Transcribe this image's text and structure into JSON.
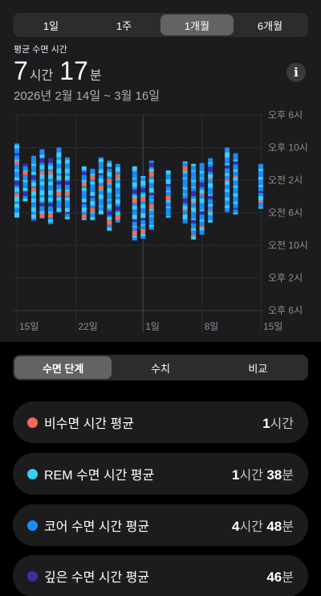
{
  "period_tabs": [
    {
      "label": "1일",
      "active": false
    },
    {
      "label": "1주",
      "active": false
    },
    {
      "label": "1개월",
      "active": true
    },
    {
      "label": "6개월",
      "active": false
    }
  ],
  "summary": {
    "label": "평균 수면 시간",
    "hours": "7",
    "hours_unit": "시간",
    "minutes": "17",
    "minutes_unit": "분",
    "info_icon": "i",
    "date_range": "2026년 2월 14일 ~ 3월 16일"
  },
  "chart_data": {
    "type": "bar",
    "y_ticks": [
      "오후 6시",
      "오후 10시",
      "오전 2시",
      "오전 6시",
      "오전 10시",
      "오후 2시",
      "오후 6시"
    ],
    "x_ticks": [
      "15일",
      "22일",
      "1일",
      "8일",
      "15일"
    ],
    "colors": {
      "awake": "#f46a52",
      "rem": "#3ad0f5",
      "core": "#1a8cff",
      "deep": "#3a2ea8"
    },
    "series": [
      {
        "day": "2월 14일",
        "bed": 21.5,
        "wake": 30.6
      },
      {
        "day": "2월 15일",
        "bed": 24.0,
        "wake": 28.6
      },
      {
        "day": "2월 16일",
        "bed": 23.0,
        "wake": 31.1
      },
      {
        "day": "2월 17일",
        "bed": 22.2,
        "wake": 30.7
      },
      {
        "day": "2월 18일",
        "bed": 23.3,
        "wake": 31.4
      },
      {
        "day": "2월 19일",
        "bed": 22.0,
        "wake": 30.0
      },
      {
        "day": "2월 20일",
        "bed": 23.2,
        "wake": 30.8
      },
      {
        "day": "2월 21일",
        "bed": null,
        "wake": null
      },
      {
        "day": "2월 22일",
        "bed": 24.3,
        "wake": 30.9
      },
      {
        "day": "2월 23일",
        "bed": 24.6,
        "wake": 30.9
      },
      {
        "day": "2월 24일",
        "bed": 23.2,
        "wake": 30.2
      },
      {
        "day": "2월 25일",
        "bed": 23.6,
        "wake": 32.2
      },
      {
        "day": "2월 26일",
        "bed": 24.0,
        "wake": 31.2
      },
      {
        "day": "2월 27일",
        "bed": null,
        "wake": null
      },
      {
        "day": "2월 28일",
        "bed": 24.3,
        "wake": 33.4
      },
      {
        "day": "3월 1일",
        "bed": 25.5,
        "wake": 33.2
      },
      {
        "day": "3월 2일",
        "bed": 23.6,
        "wake": 32.1
      },
      {
        "day": "3월 3일",
        "bed": null,
        "wake": null
      },
      {
        "day": "3월 4일",
        "bed": 24.8,
        "wake": 30.6
      },
      {
        "day": "3월 5일",
        "bed": null,
        "wake": null
      },
      {
        "day": "3월 6일",
        "bed": 23.7,
        "wake": 31.3
      },
      {
        "day": "3월 7일",
        "bed": 24.0,
        "wake": 33.3
      },
      {
        "day": "3월 8일",
        "bed": 23.9,
        "wake": 32.7
      },
      {
        "day": "3월 9일",
        "bed": 23.3,
        "wake": 31.2
      },
      {
        "day": "3월 10일",
        "bed": null,
        "wake": null
      },
      {
        "day": "3월 11일",
        "bed": 22.0,
        "wake": 30.0
      },
      {
        "day": "3월 12일",
        "bed": 22.7,
        "wake": 30.2
      },
      {
        "day": "3월 13일",
        "bed": null,
        "wake": null
      },
      {
        "day": "3월 14일",
        "bed": null,
        "wake": null
      },
      {
        "day": "3월 15일",
        "bed": 24.0,
        "wake": 29.5
      }
    ]
  },
  "view_tabs": [
    {
      "label": "수면 단계",
      "active": true
    },
    {
      "label": "수치",
      "active": false
    },
    {
      "label": "비교",
      "active": false
    }
  ],
  "stages": [
    {
      "name": "비수면 시간 평균",
      "color": "#f46a52",
      "h": "1",
      "h_unit": "시간",
      "m": "",
      "m_unit": ""
    },
    {
      "name": "REM 수면 시간 평균",
      "color": "#3ad0f5",
      "h": "1",
      "h_unit": "시간",
      "m": "38",
      "m_unit": "분"
    },
    {
      "name": "코어 수면 시간 평균",
      "color": "#1a8cff",
      "h": "4",
      "h_unit": "시간",
      "m": "48",
      "m_unit": "분"
    },
    {
      "name": "깊은 수면 시간 평균",
      "color": "#3a2ea8",
      "h": "",
      "h_unit": "",
      "m": "46",
      "m_unit": "분"
    }
  ]
}
